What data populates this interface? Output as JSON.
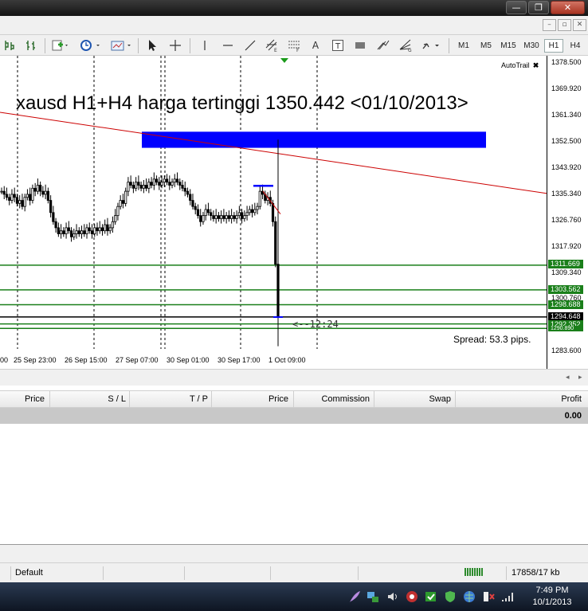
{
  "window": {
    "minimize": "—",
    "restore": "❐",
    "close": "✕",
    "mdi_minimize": "–",
    "mdi_restore": "▫",
    "mdi_close": "✕"
  },
  "toolbar": {
    "timeframes": [
      "M1",
      "M5",
      "M15",
      "M30",
      "H1",
      "H4"
    ],
    "selected_timeframe": "H1",
    "text_tool": "A",
    "label_tool": "T"
  },
  "chart": {
    "headline": "xausd H1+H4 harga tertinggi 1350.442 <01/10/2013>",
    "autotrail_label": "AutoTrail",
    "autotrail_close": "✖",
    "spread_text": "Spread: 53.3 pips.",
    "time_marker": "<--12:24",
    "colors": {
      "zone": "#0000ff",
      "trendline": "#cc0000",
      "level": "#1a7f1a",
      "candle": "#000000",
      "bid": "#000000"
    }
  },
  "chart_data": {
    "type": "candlestick",
    "y_ticks": [
      "1378.500",
      "1369.920",
      "1361.340",
      "1352.500",
      "1343.920",
      "1335.340",
      "1326.760",
      "1317.920",
      "1309.340",
      "1300.760",
      "1283.600"
    ],
    "ylim": [
      1283.6,
      1378.5
    ],
    "x_labels": [
      "00",
      "25 Sep 23:00",
      "26 Sep 15:00",
      "27 Sep 07:00",
      "30 Sep 01:00",
      "30 Sep 17:00",
      "1 Oct 09:00"
    ],
    "price_levels": [
      {
        "value": "1311.669",
        "color": "#1a7f1a"
      },
      {
        "value": "1303.562",
        "color": "#1a7f1a"
      },
      {
        "value": "1298.688",
        "color": "#1a7f1a"
      },
      {
        "value": "1294.648",
        "color": "#000000"
      },
      {
        "value": "1292.352",
        "color": "#1a7f1a"
      },
      {
        "value": "1290.890",
        "color": "#1a7f1a"
      }
    ],
    "resistance_zone": [
      1350.3,
      1355.6
    ],
    "trendline": {
      "from": 1362.0,
      "to": 1335.3
    },
    "closes": [
      1336,
      1335,
      1334,
      1333,
      1335,
      1334,
      1332,
      1333,
      1331,
      1334,
      1335,
      1333,
      1337,
      1336,
      1338,
      1336,
      1335,
      1336,
      1333,
      1329,
      1326,
      1324,
      1322,
      1323,
      1322,
      1324,
      1323,
      1321,
      1322,
      1323,
      1322,
      1323,
      1322,
      1324,
      1323,
      1322,
      1324,
      1323,
      1324,
      1323,
      1325,
      1323,
      1324,
      1326,
      1328,
      1331,
      1333,
      1332,
      1336,
      1339,
      1338,
      1337,
      1339,
      1338,
      1337,
      1338,
      1337,
      1339,
      1338,
      1340,
      1339,
      1338,
      1339,
      1340,
      1339,
      1338,
      1339,
      1340,
      1339,
      1338,
      1337,
      1336,
      1335,
      1333,
      1331,
      1330,
      1328,
      1326,
      1328,
      1330,
      1329,
      1328,
      1327,
      1328,
      1327,
      1328,
      1327,
      1328,
      1327,
      1328,
      1327,
      1328,
      1329,
      1327,
      1328,
      1329,
      1330,
      1329,
      1330,
      1331,
      1336,
      1335,
      1333,
      1334,
      1332,
      1326,
      1312,
      1294.6
    ]
  },
  "terminal": {
    "columns": [
      "Price",
      "S / L",
      "T / P",
      "Price",
      "Commission",
      "Swap",
      "Profit"
    ],
    "total_profit": "0.00"
  },
  "status": {
    "profile": "Default",
    "traffic": "17858/17 kb"
  },
  "taskbar": {
    "time": "7:49 PM",
    "date": "10/1/2013"
  }
}
